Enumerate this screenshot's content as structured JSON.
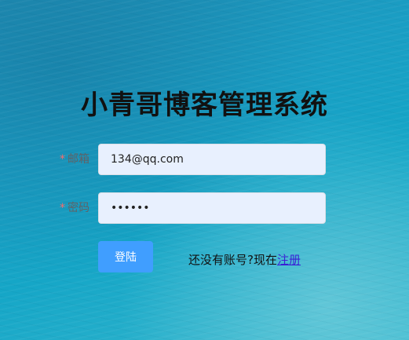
{
  "title": "小青哥博客管理系统",
  "form": {
    "email": {
      "required_mark": "*",
      "label": "邮箱",
      "value": "134@qq.com",
      "placeholder": ""
    },
    "password": {
      "required_mark": "*",
      "label": "密码",
      "value": "123456",
      "placeholder": ""
    },
    "login_label": "登陆"
  },
  "register": {
    "prompt": "还没有账号?现在",
    "link_label": "注册"
  },
  "colors": {
    "primary_button": "#409eff",
    "input_background": "#e8f0fe",
    "required_star": "#f56c6c",
    "link": "#3a1fd6"
  }
}
